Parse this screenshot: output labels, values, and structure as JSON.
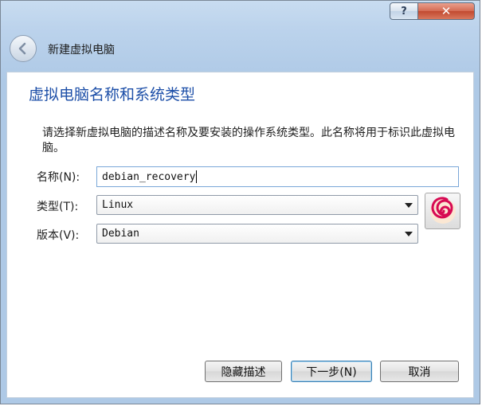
{
  "titlebar": {
    "help_label": "?",
    "close_label": "✕"
  },
  "wizard": {
    "title": "新建虚拟电脑",
    "heading": "虚拟电脑名称和系统类型",
    "description": "请选择新虚拟电脑的描述名称及要安装的操作系统类型。此名称将用于标识此虚拟电脑。"
  },
  "form": {
    "name_label": "名称(N):",
    "name_value": "debian_recovery",
    "type_label": "类型(T):",
    "type_value": "Linux",
    "version_label": "版本(V):",
    "version_value": "Debian",
    "os_icon": "debian-swirl-icon"
  },
  "buttons": {
    "hide_description": "隐藏描述",
    "next": "下一步(N)",
    "cancel": "取消"
  },
  "colors": {
    "heading": "#1d4fa8",
    "focus_border": "#7aa7d8",
    "close_button": "#c24a30",
    "debian_red": "#d70a53"
  }
}
